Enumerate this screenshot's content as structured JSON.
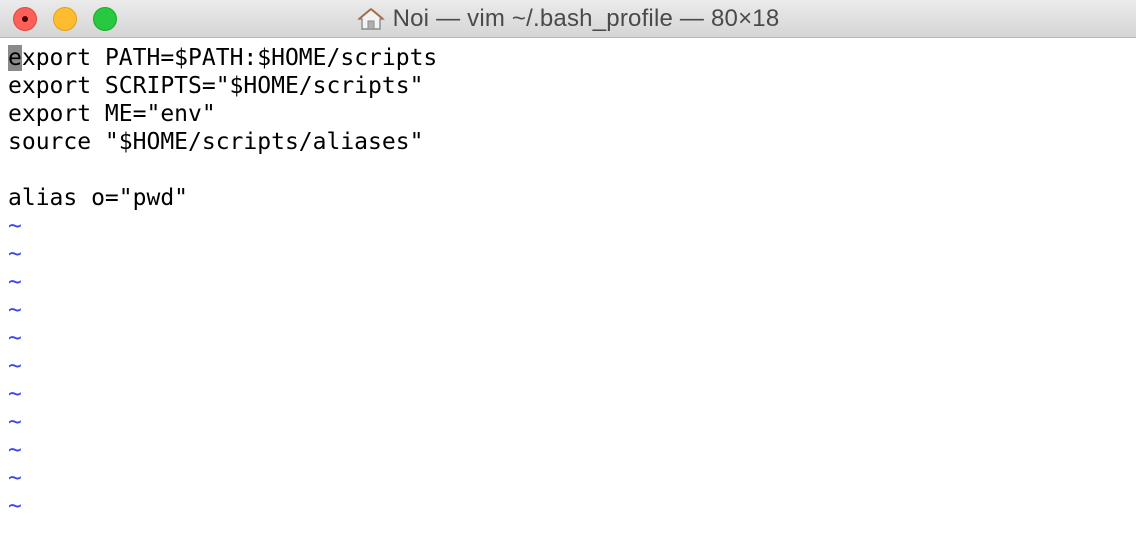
{
  "window": {
    "title": "Noi — vim ~/.bash_profile — 80×18",
    "title_icon": "home-icon"
  },
  "colors": {
    "close": "#fe5f57",
    "minimize": "#febc2e",
    "zoom": "#28c840",
    "tilde": "#3a3ff0",
    "cursor": "#8a8a8a"
  },
  "editor": {
    "cursor_char": "e",
    "first_line_rest": "xport PATH=$PATH:$HOME/scripts",
    "lines": [
      "export SCRIPTS=\"$HOME/scripts\"",
      "export ME=\"env\"",
      "source \"$HOME/scripts/aliases\"",
      "",
      "alias o=\"pwd\""
    ],
    "tildes": [
      "~",
      "~",
      "~",
      "~",
      "~",
      "~",
      "~",
      "~",
      "~",
      "~",
      "~"
    ]
  }
}
